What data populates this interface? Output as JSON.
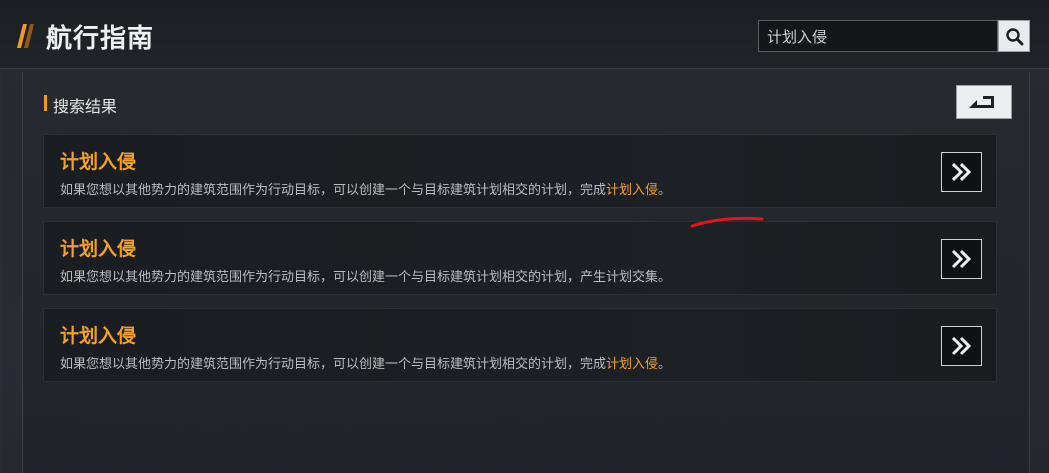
{
  "header": {
    "title": "航行指南",
    "search": {
      "value": "计划入侵",
      "placeholder": "计划入侵",
      "button_icon": "search-icon"
    }
  },
  "section": {
    "label": "搜索结果",
    "back_icon": "return-arrow-icon"
  },
  "results": [
    {
      "title": "计划入侵",
      "desc_prefix": "如果您想以其他势力的建筑范围作为行动目标，可以创建一个与目标建筑计划相交的计划，",
      "desc_mid": "完成",
      "desc_highlight": "计划入侵",
      "desc_suffix": "。",
      "button_icon": "double-chevron-right-icon"
    },
    {
      "title": "计划入侵",
      "desc_prefix": "如果您想以其他势力的建筑范围作为行动目标，可以创建一个与目标建筑计划相交的计划，",
      "desc_mid": "产生计划交集。",
      "desc_highlight": "",
      "desc_suffix": "",
      "button_icon": "double-chevron-right-icon"
    },
    {
      "title": "计划入侵",
      "desc_prefix": "如果您想以其他势力的建筑范围作为行动目标，可以创建一个与目标建筑计划相交的计划，",
      "desc_mid": "完成",
      "desc_highlight": "计划入侵",
      "desc_suffix": "。",
      "button_icon": "double-chevron-right-icon"
    }
  ],
  "colors": {
    "accent": "#f29a1e",
    "annotation": "#e3141c"
  }
}
